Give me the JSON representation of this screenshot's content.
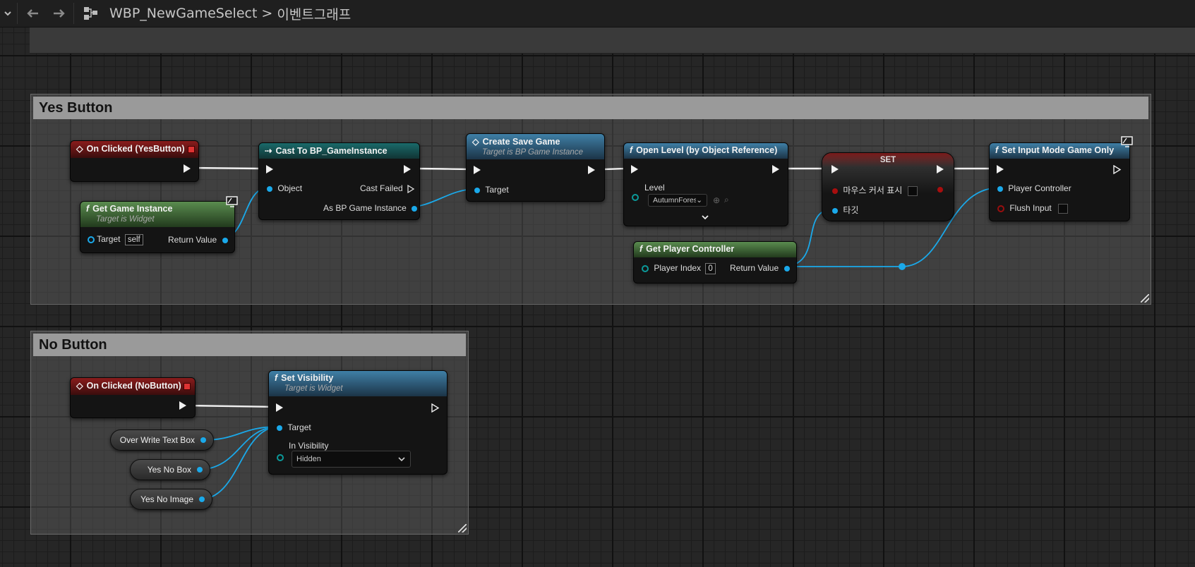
{
  "header": {
    "back_icon": "arrow-left-icon",
    "forward_icon": "arrow-right-icon",
    "breadcrumb": [
      "WBP_NewGameSelect",
      "이벤트그래프"
    ],
    "separator": ">"
  },
  "comments": {
    "yes": {
      "title": "Yes Button"
    },
    "no": {
      "title": "No Button"
    }
  },
  "nodes": {
    "on_clicked_yes": {
      "title": "On Clicked (YesButton)"
    },
    "get_game_instance": {
      "title": "Get Game Instance",
      "subtitle": "Target is Widget",
      "target_label": "Target",
      "target_value": "self",
      "return_label": "Return Value"
    },
    "cast": {
      "title": "Cast To BP_GameInstance",
      "object_label": "Object",
      "cast_failed_label": "Cast Failed",
      "as_label": "As BP Game Instance"
    },
    "create_save": {
      "title": "Create Save Game",
      "subtitle": "Target is BP Game Instance",
      "target_label": "Target"
    },
    "open_level": {
      "title": "Open Level (by Object Reference)",
      "level_label": "Level",
      "level_value": "AutumnForest_C"
    },
    "get_pc": {
      "title": "Get Player Controller",
      "index_label": "Player Index",
      "index_value": "0",
      "return_label": "Return Value"
    },
    "set": {
      "title": "SET",
      "var1_label": "마우스 커서 표시",
      "var2_label": "타깃"
    },
    "input_mode": {
      "title": "Set Input Mode Game Only",
      "pc_label": "Player Controller",
      "flush_label": "Flush Input"
    },
    "on_clicked_no": {
      "title": "On Clicked (NoButton)"
    },
    "set_visibility": {
      "title": "Set Visibility",
      "subtitle": "Target is Widget",
      "target_label": "Target",
      "vis_label": "In Visibility",
      "vis_value": "Hidden"
    },
    "var_overwrite": {
      "label": "Over Write Text Box"
    },
    "var_yesnobox": {
      "label": "Yes No Box"
    },
    "var_yesnoimage": {
      "label": "Yes No Image"
    }
  },
  "colors": {
    "object_pin": "#1aa9ea",
    "exec_pin": "#f0f0f0",
    "bool_pin": "#a80e0e",
    "event_header": "#8a1c1c",
    "function_header": "#3f7fa6",
    "pure_header": "#5a8c4f",
    "cast_header": "#1a6a6a"
  }
}
